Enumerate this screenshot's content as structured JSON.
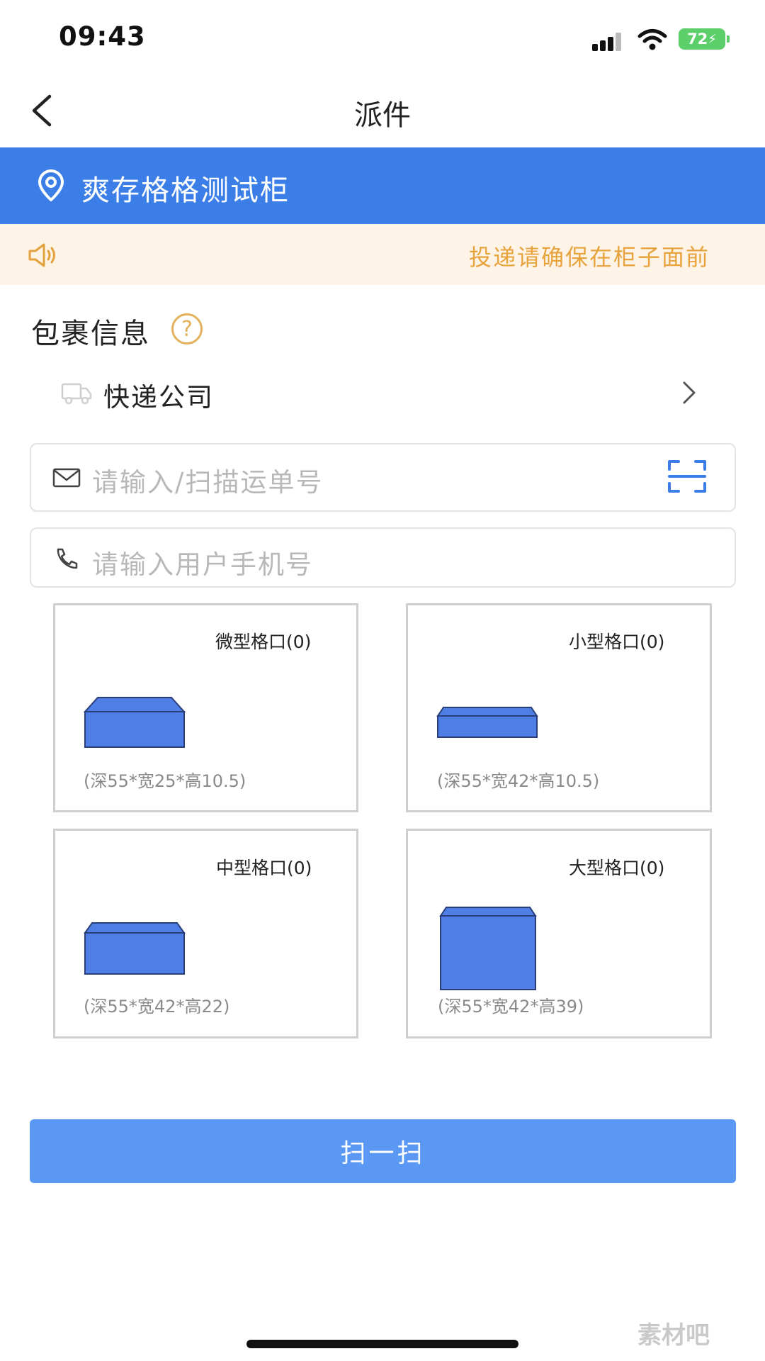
{
  "status_bar": {
    "time": "09:43",
    "battery": "72"
  },
  "nav": {
    "title": "派件"
  },
  "location": {
    "name": "爽存格格测试柜"
  },
  "notice": {
    "text": "投递请确保在柜子面前"
  },
  "package_info": {
    "title": "包裹信息",
    "help_symbol": "?",
    "courier_label": "快递公司"
  },
  "inputs": {
    "tracking_placeholder": "请输入/扫描运单号",
    "phone_placeholder": "请输入用户手机号"
  },
  "lockers": [
    {
      "name": "微型格口(0)",
      "dims": "(深55*宽25*高10.5)"
    },
    {
      "name": "小型格口(0)",
      "dims": "(深55*宽42*高10.5)"
    },
    {
      "name": "中型格口(0)",
      "dims": "(深55*宽42*高22)"
    },
    {
      "name": "大型格口(0)",
      "dims": "(深55*宽42*高39)"
    }
  ],
  "actions": {
    "scan_label": "扫一扫"
  },
  "watermark": {
    "text": "素材吧"
  },
  "colors": {
    "primary": "#3b7ee8",
    "button": "#5b98f3",
    "notice_bg": "#fdf3e7",
    "notice_text": "#e8a33c",
    "box_fill": "#4f7fe6"
  }
}
